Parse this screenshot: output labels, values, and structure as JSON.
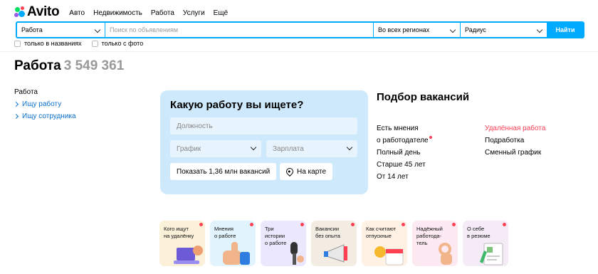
{
  "brand": {
    "logo_text": "Avito",
    "accent": "#00aaff",
    "red": "#ff4053"
  },
  "nav": {
    "links": [
      "Авто",
      "Недвижимость",
      "Работа",
      "Услуги",
      "Ещё"
    ]
  },
  "search": {
    "category": "Работа",
    "query_placeholder": "Поиск по объявлениям",
    "region": "Во всех регионах",
    "radius": "Радиус",
    "submit": "Найти",
    "checkbox_titles": "только в названиях",
    "checkbox_photo": "только с фото"
  },
  "page": {
    "title": "Работа",
    "count": "3 549 361"
  },
  "sidebar": {
    "heading": "Работа",
    "items": [
      {
        "label": "Ищу работу"
      },
      {
        "label": "Ищу сотрудника"
      }
    ]
  },
  "finder": {
    "title": "Какую работу вы ищете?",
    "profession_placeholder": "Должность",
    "schedule": "График",
    "salary": "Зарплата",
    "show_button": "Показать 1,36 млн вакансий",
    "map_button": "На карте"
  },
  "selection": {
    "title": "Подбор вакансий",
    "left": [
      "Есть мнения",
      "о работодателе",
      "Полный день",
      "Старше 45 лет",
      "От 14 лет"
    ],
    "right": [
      "Удалённая работа",
      "Подработка",
      "Сменный график"
    ]
  },
  "stories": [
    {
      "lines": [
        "Кого ищут",
        "на удалёнку"
      ]
    },
    {
      "lines": [
        "Мнения",
        "о работе"
      ]
    },
    {
      "lines": [
        "Три",
        "истории",
        "о работе"
      ]
    },
    {
      "lines": [
        "Вакансии",
        "без опыта"
      ]
    },
    {
      "lines": [
        "Как считают",
        "отпускные"
      ]
    },
    {
      "lines": [
        "Надёжный",
        "работода-",
        "тель"
      ]
    },
    {
      "lines": [
        "О себе",
        "в резюме"
      ]
    }
  ]
}
